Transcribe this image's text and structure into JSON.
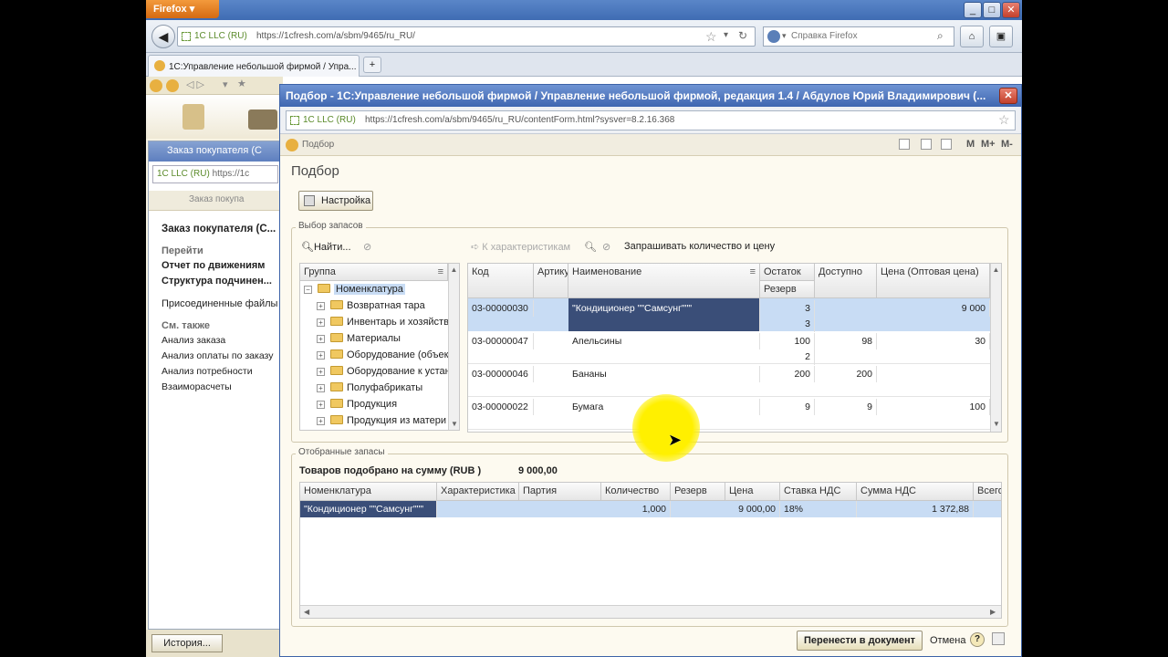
{
  "firefox": {
    "menu_label": "Firefox",
    "window_controls": [
      "_",
      "□",
      "✕"
    ],
    "site_identity": "1C LLC (RU)",
    "url": "https://1cfresh.com/a/sbm/9465/ru_RU/",
    "search_placeholder": "Справка Firefox",
    "tab_title": "1С:Управление небольшой фирмой / Упра...",
    "new_tab": "+"
  },
  "background_window": {
    "title": "Заказ покупателя (С",
    "site_identity": "1C LLC (RU)",
    "url_fragment": "https://1c",
    "toolbar_text": "Заказ покупа",
    "heading": "Заказ покупателя (С...",
    "goto_label": "Перейти",
    "goto_items": [
      "Отчет по движениям",
      "Структура подчинен...",
      "Присоединенные файлы"
    ],
    "see_also_label": "См. также",
    "see_also_items": [
      "Анализ заказа",
      "Анализ оплаты по заказу",
      "Анализ потребности",
      "Взаиморасчеты"
    ],
    "history_button": "История..."
  },
  "popup": {
    "title": "Подбор - 1С:Управление небольшой фирмой / Управление небольшой фирмой, редакция 1.4 / Абдулов Юрий Владимирович (...",
    "close": "✕",
    "site_identity": "1C LLC (RU)",
    "url": "https://1cfresh.com/a/sbm/9465/ru_RU/contentForm.html?sysver=8.2.16.368",
    "form_tab": "Подбор",
    "header_buttons": [
      "M",
      "M+",
      "M-"
    ],
    "heading": "Подбор",
    "settings_button": "Настройка",
    "stock_group_title": "Выбор запасов",
    "find_button": "Найти...",
    "to_characteristics_button": "К характеристикам",
    "ask_qty_price_label": "Запрашивать количество и цену",
    "tree_header": "Группа",
    "tree_root": "Номенклатура",
    "tree_items": [
      "Возвратная тара",
      "Инвентарь и хозяйств",
      "Материалы",
      "Оборудование (объек",
      "Оборудование к устан",
      "Полуфабрикаты",
      "Продукция",
      "Продукция из матери"
    ],
    "grid_headers": {
      "code": "Код",
      "article": "Артикул",
      "name": "Наименование",
      "remainder": "Остаток",
      "reserve": "Резерв",
      "available": "Доступно",
      "price": "Цена (Оптовая цена)"
    },
    "grid_rows": [
      {
        "code": "03-00000030",
        "article": "",
        "name": "\"Кондиционер \"\"Самсунг\"\"\"",
        "remainder": "3",
        "reserve": "3",
        "available": "",
        "price": "9 000"
      },
      {
        "code": "03-00000047",
        "article": "",
        "name": "Апельсины",
        "remainder": "100",
        "reserve": "2",
        "available": "98",
        "price": "30"
      },
      {
        "code": "03-00000046",
        "article": "",
        "name": "Бананы",
        "remainder": "200",
        "reserve": "",
        "available": "200",
        "price": ""
      },
      {
        "code": "03-00000022",
        "article": "",
        "name": "Бумага",
        "remainder": "9",
        "reserve": "",
        "available": "9",
        "price": "100"
      }
    ],
    "selected_group_title": "Отобранные запасы",
    "total_label": "Товаров подобрано на сумму (RUB )",
    "total_value": "9 000,00",
    "selected_headers": [
      "Номенклатура",
      "Характеристика",
      "Партия",
      "Количество",
      "Резерв",
      "Цена",
      "Ставка НДС",
      "Сумма НДС",
      "Всего"
    ],
    "selected_rows": [
      {
        "name": "\"Кондиционер \"\"Самсунг\"\"\"",
        "characteristic": "",
        "batch": "",
        "quantity": "1,000",
        "reserve": "",
        "price": "9 000,00",
        "vat_rate": "18%",
        "vat_sum": "1 372,88",
        "total": ""
      }
    ],
    "transfer_button": "Перенести в документ",
    "cancel_button": "Отмена",
    "help_button": "?"
  }
}
